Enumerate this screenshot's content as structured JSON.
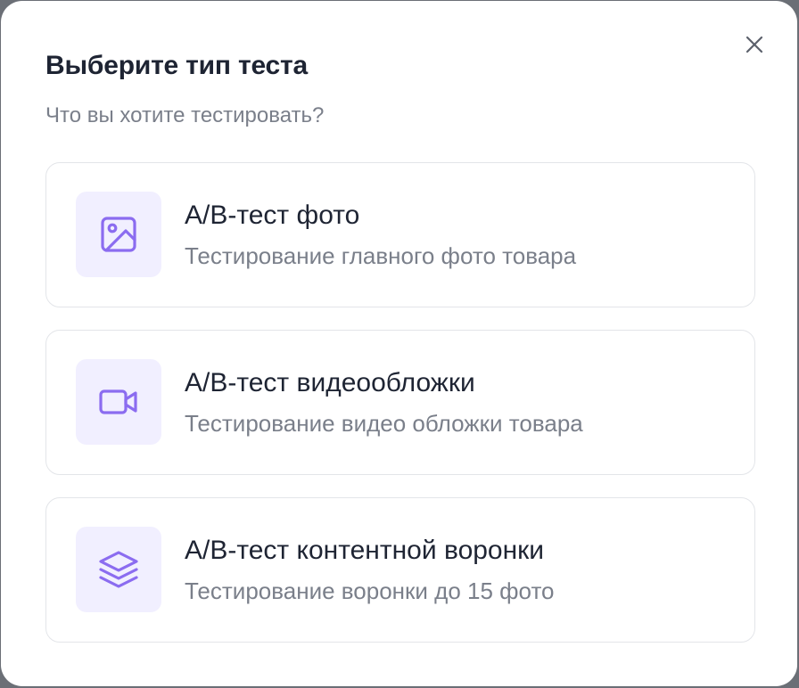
{
  "modal": {
    "title": "Выберите тип теста",
    "subtitle": "Что вы хотите тестировать?",
    "close_icon": "close-icon"
  },
  "options": [
    {
      "title": "A/B-тест фото",
      "description": "Тестирование главного фото товара",
      "icon": "image-icon"
    },
    {
      "title": "A/B-тест видеообложки",
      "description": "Тестирование видео обложки товара",
      "icon": "video-icon"
    },
    {
      "title": "A/B-тест контентной воронки",
      "description": "Тестирование воронки до 15 фото",
      "icon": "layers-icon"
    }
  ],
  "colors": {
    "accent": "#8b6cf0",
    "icon_bg": "#f1efff",
    "title": "#1e2433",
    "muted": "#7a7f8a",
    "border": "#e3e5e9"
  }
}
